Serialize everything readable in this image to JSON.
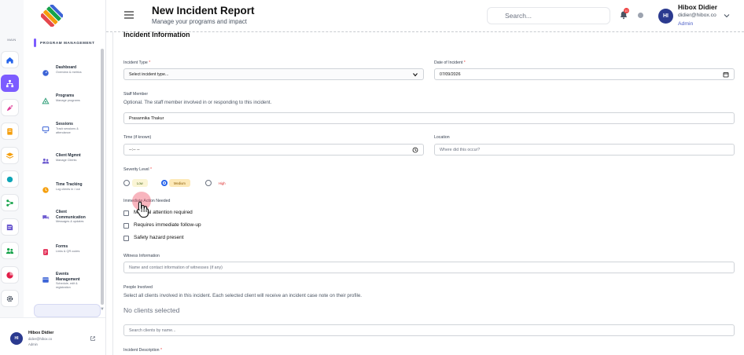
{
  "rail": {
    "label": "MAIN",
    "items": [
      {
        "icon": "home-icon",
        "color": "#2563eb",
        "active": false
      },
      {
        "icon": "sitemap-icon",
        "color": "#ffffff",
        "active": true
      },
      {
        "icon": "rocket-icon",
        "color": "#e0409a",
        "active": false
      },
      {
        "icon": "book-icon",
        "color": "#f59e0b",
        "active": false
      },
      {
        "icon": "layers-icon",
        "color": "#f59e0b",
        "active": false
      },
      {
        "icon": "circle-icon",
        "color": "#0ea5b7",
        "active": false
      },
      {
        "icon": "share-icon",
        "color": "#16a34a",
        "active": false
      },
      {
        "icon": "note-icon",
        "color": "#6d5bd0",
        "active": false
      },
      {
        "icon": "users-icon",
        "color": "#16a34a",
        "active": false
      },
      {
        "icon": "pie-chart-icon",
        "color": "#e11d48",
        "active": false
      },
      {
        "icon": "gear-icon",
        "color": "#374151",
        "active": false
      }
    ]
  },
  "program_nav": {
    "title": "PROGRAM MANAGEMENT",
    "items": [
      {
        "title": "Dashboard",
        "subtitle": [
          "Overview & metrics"
        ],
        "icon": "dashboard-icon",
        "color": "#3b63d6"
      },
      {
        "title": "Programs",
        "subtitle": [
          "Manage programs"
        ],
        "icon": "programs-icon",
        "color": "#2f9e78"
      },
      {
        "title": "Sessions",
        "subtitle": [
          "Track sessions &",
          "attendance"
        ],
        "icon": "sessions-icon",
        "color": "#3b63d6"
      },
      {
        "title": "Client Mgmnt",
        "subtitle": [
          "Manage Clients"
        ],
        "icon": "client-mgmt-icon",
        "color": "#6d5bd0"
      },
      {
        "title": "Time Tracking",
        "subtitle": [
          "Log clients in / out"
        ],
        "icon": "clock-icon",
        "color": "#f59e0b"
      },
      {
        "title": "Client Communication",
        "subtitle": [
          "Messages & updates"
        ],
        "icon": "chat-icon",
        "color": "#6d5bd0"
      },
      {
        "title": "Forms",
        "subtitle": [
          "Links & QR codes"
        ],
        "icon": "forms-icon",
        "color": "#e11d48"
      },
      {
        "title": "Events Management",
        "subtitle": [
          "Schedule, edit &",
          "registration"
        ],
        "icon": "calendar-icon",
        "color": "#3b63d6"
      }
    ]
  },
  "sidebar_footer": {
    "initials": "HI",
    "name": "Hibox Didier",
    "email": "didier@hibox.co",
    "role": "Admin"
  },
  "header": {
    "title": "New Incident Report",
    "subtitle": "Manage your programs and impact",
    "search_placeholder": "Search...",
    "notification_count": "10",
    "user": {
      "initials": "HI",
      "name": "Hibox Didier",
      "email": "didier@hibox.co",
      "role": "Admin"
    }
  },
  "form": {
    "section_title": "Incident Information",
    "incident_type": {
      "label": "Incident Type",
      "value": "Select incident type..."
    },
    "date": {
      "label": "Date of Incident",
      "value": "07/09/2026"
    },
    "staff": {
      "label": "Staff Member",
      "help": "Optional. The staff member involved in or responding to this incident.",
      "value": "Prasannika Thakur"
    },
    "time": {
      "label": "Time (if known)",
      "value": "--:-- --"
    },
    "location": {
      "label": "Location",
      "placeholder": "Where did this occur?"
    },
    "severity": {
      "label": "Severity Level",
      "options": [
        {
          "label": "Low",
          "selected": false
        },
        {
          "label": "Medium",
          "selected": true
        },
        {
          "label": "High",
          "selected": false
        }
      ]
    },
    "immediate": {
      "label": "Immediate Action Needed",
      "options": [
        {
          "label": "Medical attention required",
          "checked": false
        },
        {
          "label": "Requires immediate follow-up",
          "checked": false
        },
        {
          "label": "Safety hazard present",
          "checked": false
        }
      ]
    },
    "witness": {
      "label": "Witness Information",
      "placeholder": "Name and contact information of witnesses (if any)"
    },
    "people": {
      "label": "People Involved",
      "help": "Select all clients involved in this incident. Each selected client will receive an incident case note on their profile.",
      "empty_text": "No clients selected",
      "search_placeholder": "Search clients by name..."
    },
    "description": {
      "label": "Incident Description"
    }
  },
  "colors": {
    "accent": "#7c5cff",
    "avatar": "#2b3a8f",
    "required": "#ef4444",
    "radio_selected": "#2563eb"
  }
}
